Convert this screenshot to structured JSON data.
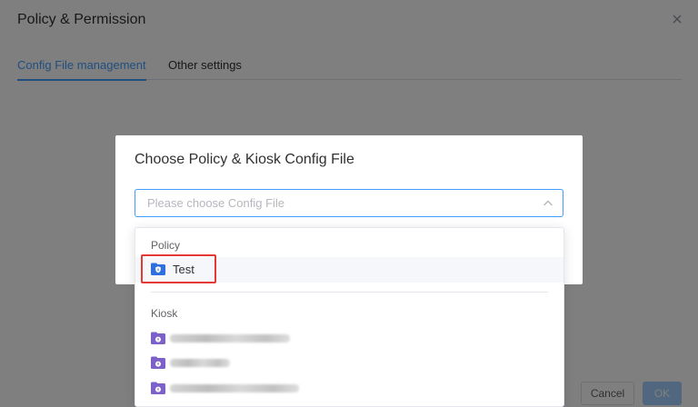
{
  "page": {
    "title": "Policy & Permission",
    "tabs": [
      {
        "label": "Config File management",
        "active": true
      },
      {
        "label": "Other settings",
        "active": false
      }
    ],
    "footer": {
      "cancel_label": "Cancel",
      "ok_label": "OK"
    }
  },
  "dialog": {
    "title": "Choose Policy & Kiosk Config File",
    "select": {
      "placeholder": "Please choose Config File"
    }
  },
  "dropdown": {
    "groups": [
      {
        "label": "Policy",
        "options": [
          {
            "label": "Test",
            "highlighted": true
          }
        ]
      },
      {
        "label": "Kiosk",
        "options": [
          {
            "label": ""
          },
          {
            "label": ""
          },
          {
            "label": ""
          }
        ]
      }
    ]
  },
  "colors": {
    "accent": "#409eff",
    "policy_icon": "#2f6fde",
    "kiosk_icon": "#7b61c9",
    "highlight": "#e53935",
    "ok_disabled": "#a0cfff"
  },
  "icons": {
    "close": "close-icon",
    "arrow": "chevron-up-icon",
    "policy_folder": "shield-folder-icon",
    "kiosk_folder": "lock-folder-icon"
  }
}
